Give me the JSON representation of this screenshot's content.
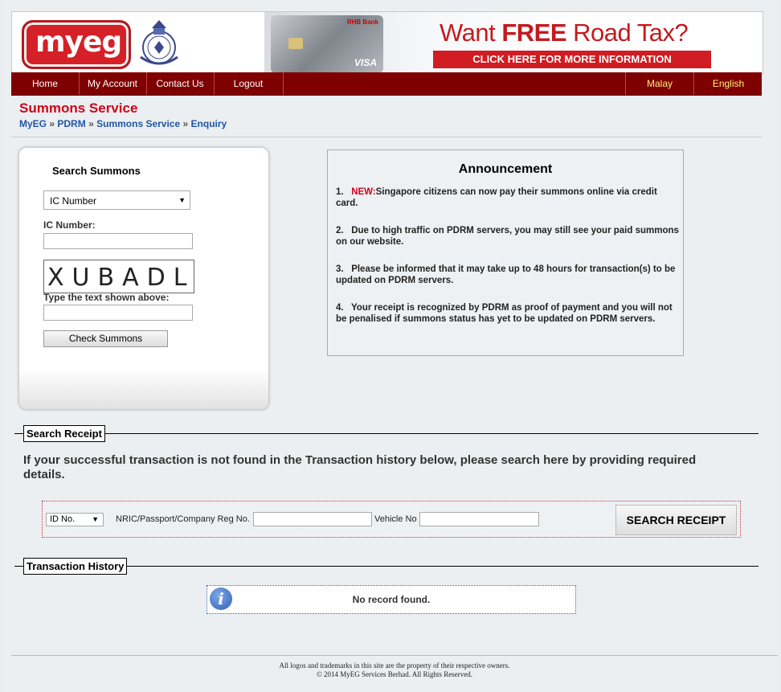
{
  "header": {
    "logo_text": "myeg",
    "card_bank": "RHB Bank",
    "card_brand": "VISA",
    "banner_prefix": "Want ",
    "banner_highlight": "FREE",
    "banner_suffix": " Road Tax?",
    "banner_cta": "CLICK HERE FOR MORE INFORMATION"
  },
  "nav": {
    "items": [
      "Home",
      "My Account",
      "Contact Us",
      "Logout"
    ],
    "languages": [
      "Malay",
      "English"
    ]
  },
  "page": {
    "title": "Summons Service",
    "breadcrumb": [
      "MyEG",
      "PDRM",
      "Summons Service",
      "Enquiry"
    ],
    "breadcrumb_sep": "»"
  },
  "search_summons": {
    "title": "Search Summons",
    "id_type_selected": "IC Number",
    "ic_label": "IC Number:",
    "ic_value": "",
    "captcha_text": "XUBADL",
    "captcha_label": "Type the text shown above:",
    "captcha_value": "",
    "button": "Check Summons"
  },
  "announcement": {
    "title": "Announcement",
    "items": [
      {
        "num": "1.",
        "tag": "NEW:",
        "text": "Singapore citizens can now pay their summons online via credit card."
      },
      {
        "num": "2.",
        "tag": "",
        "text": "Due to high traffic on PDRM servers, you may still see your paid summons on our website."
      },
      {
        "num": "3.",
        "tag": "",
        "text": "Please be informed that it may take up to 48 hours for transaction(s) to be updated on PDRM servers."
      },
      {
        "num": "4.",
        "tag": "",
        "text": "Your receipt is recognized by PDRM as proof of payment and you will not be penalised if summons status has yet to be updated on PDRM servers."
      }
    ]
  },
  "search_receipt": {
    "legend": "Search Receipt",
    "instructions": "If your successful transaction is not found in the Transaction history below, please search here by providing required details.",
    "id_type_selected": "ID No.",
    "nric_label": "NRIC/Passport/Company Reg No.",
    "vehicle_label": "Vehicle No",
    "button": "SEARCH RECEIPT"
  },
  "transaction_history": {
    "legend": "Transaction History",
    "empty_message": "No record found."
  },
  "footer": {
    "line1": "All logos and trademarks in this site are the property of their respective owners.",
    "line2": "© 2014 MyEG Services Berhad. All Rights Reserved."
  }
}
